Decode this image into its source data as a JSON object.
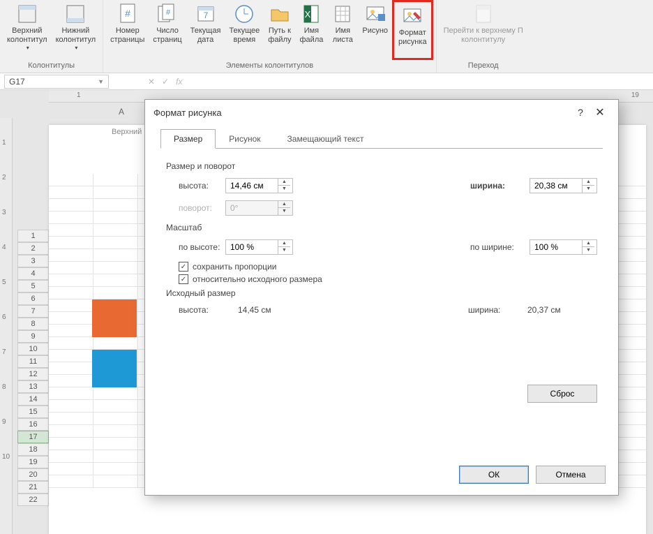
{
  "ribbon": {
    "group1": {
      "label": "Колонтитулы",
      "btn_header": "Верхний\nколонтитул",
      "btn_footer": "Нижний\nколонтитул"
    },
    "group2": {
      "label": "Элементы колонтитулов",
      "btn_pagenum": "Номер\nстраницы",
      "btn_pagecount": "Число\nстраниц",
      "btn_curdate": "Текущая\nдата",
      "btn_curtime": "Текущее\nвремя",
      "btn_filepath": "Путь к\nфайлу",
      "btn_filename": "Имя\nфайла",
      "btn_sheetname": "Имя\nлиста",
      "btn_picture": "Рисуно",
      "btn_fmtpicture": "Формат\nрисунка"
    },
    "group3": {
      "label": "Переход",
      "btn_goto": "Перейти к верхнему П\nколонтитулу"
    }
  },
  "namebox": "G17",
  "colhead_A": "A",
  "ruler_marks": {
    "m1": "1",
    "m19": "19"
  },
  "ruler_v": {
    "m1": "1",
    "m2": "2",
    "m3": "3",
    "m4": "4",
    "m5": "5",
    "m6": "6",
    "m7": "7",
    "m8": "8",
    "m9": "9",
    "m10": "10"
  },
  "page_header_label": "Верхний",
  "rows": [
    "1",
    "2",
    "3",
    "4",
    "5",
    "6",
    "7",
    "8",
    "9",
    "10",
    "11",
    "12",
    "13",
    "14",
    "15",
    "16",
    "17",
    "18",
    "19",
    "20",
    "21",
    "22"
  ],
  "selected_row": "17",
  "dialog": {
    "title": "Формат рисунка",
    "tabs": {
      "size": "Размер",
      "picture": "Рисунок",
      "alttext": "Замещающий текст"
    },
    "section_size": "Размер и поворот",
    "height_lbl": "высота:",
    "height_val": "14,46 см",
    "width_lbl": "ширина:",
    "width_val": "20,38 см",
    "rotation_lbl": "поворот:",
    "rotation_val": "0°",
    "section_scale": "Масштаб",
    "scale_h_lbl": "по высоте:",
    "scale_h_val": "100 %",
    "scale_w_lbl": "по ширине:",
    "scale_w_val": "100 %",
    "chk_lock": "сохранить пропорции",
    "chk_rel": "относительно исходного размера",
    "section_orig": "Исходный размер",
    "orig_h_lbl": "высота:",
    "orig_h_val": "14,45 см",
    "orig_w_lbl": "ширина:",
    "orig_w_val": "20,37 см",
    "btn_reset": "Сброс",
    "btn_ok": "ОК",
    "btn_cancel": "Отмена"
  }
}
